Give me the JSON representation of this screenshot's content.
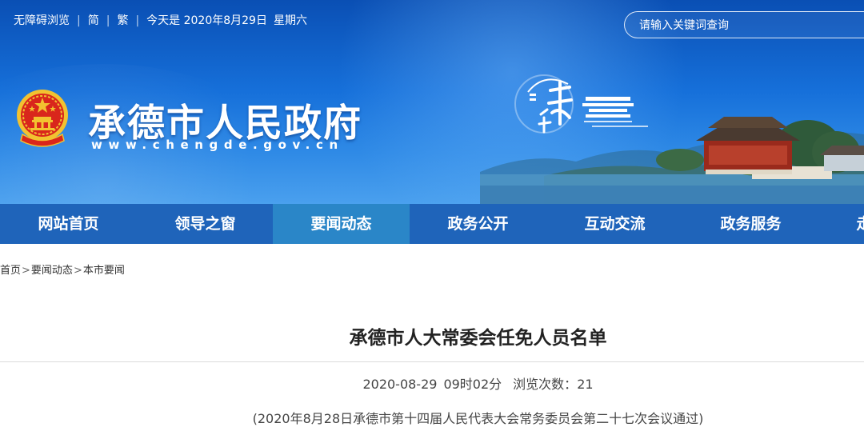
{
  "topbar": {
    "accessibility": "无障碍浏览",
    "simplified": "简",
    "traditional": "繁",
    "date_prefix": "今天是",
    "date": "2020年8月29日",
    "weekday": "星期六"
  },
  "search": {
    "placeholder": "请输入关键词查询"
  },
  "site": {
    "title": "承德市人民政府",
    "url": "www.chengde.gov.cn"
  },
  "colors": {
    "banner_blue": "#1670da",
    "nav_bg": "#1f64ba",
    "nav_active": "#2a86c8"
  },
  "nav": [
    {
      "label": "网站首页"
    },
    {
      "label": "领导之窗"
    },
    {
      "label": "要闻动态",
      "active": true
    },
    {
      "label": "政务公开"
    },
    {
      "label": "互动交流"
    },
    {
      "label": "政务服务"
    },
    {
      "label": "走"
    }
  ],
  "breadcrumb": [
    "首页",
    "要闻动态",
    "本市要闻"
  ],
  "article": {
    "title": "承德市人大常委会任免人员名单",
    "date": "2020-08-29",
    "time": "09时02分",
    "views_label": "浏览次数：",
    "views": "21",
    "subtitle": "(2020年8月28日承德市第十四届人民代表大会常务委员会第二十七次会议通过)"
  }
}
